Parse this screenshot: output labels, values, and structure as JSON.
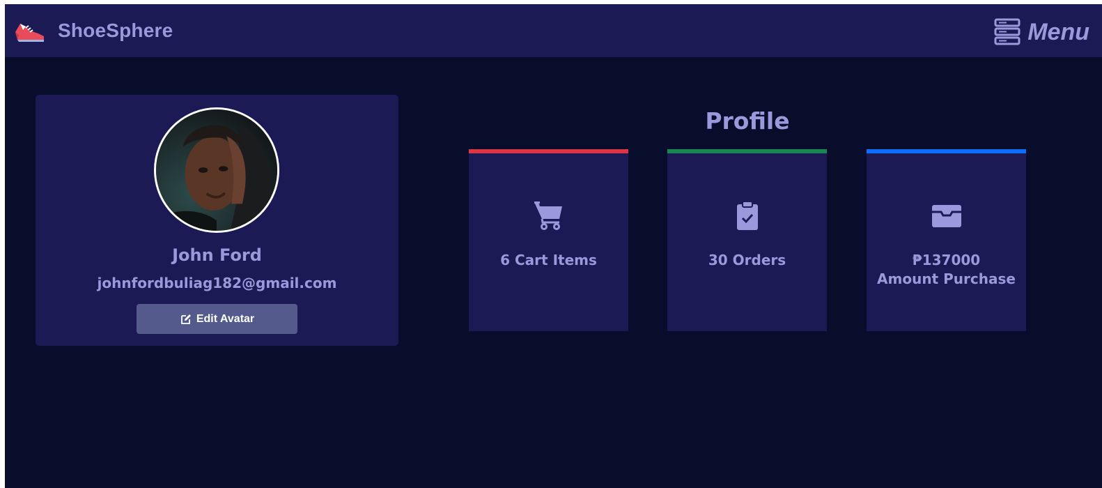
{
  "navbar": {
    "brand_name": "ShoeSphere",
    "brand_icon": "sneaker-icon",
    "menu_label": "Menu",
    "menu_icon": "server-stack-icon"
  },
  "profile": {
    "name": "John Ford",
    "email": "johnfordbuliag182@gmail.com",
    "edit_avatar_label": "Edit Avatar",
    "edit_icon": "pencil-square-icon"
  },
  "section_title": "Profile",
  "stats": [
    {
      "icon": "cart-icon",
      "accent": "#dc3545",
      "line1": "6 Cart Items",
      "line2": ""
    },
    {
      "icon": "clipboard-check-icon",
      "accent": "#198754",
      "line1": "30 Orders",
      "line2": ""
    },
    {
      "icon": "inbox-icon",
      "accent": "#0d6efd",
      "line1": "₱137000",
      "line2": "Amount Purchase"
    }
  ],
  "colors": {
    "background": "#070d2a",
    "panel": "#1c1a55",
    "text": "#9b98dc",
    "button": "#545b8c"
  }
}
